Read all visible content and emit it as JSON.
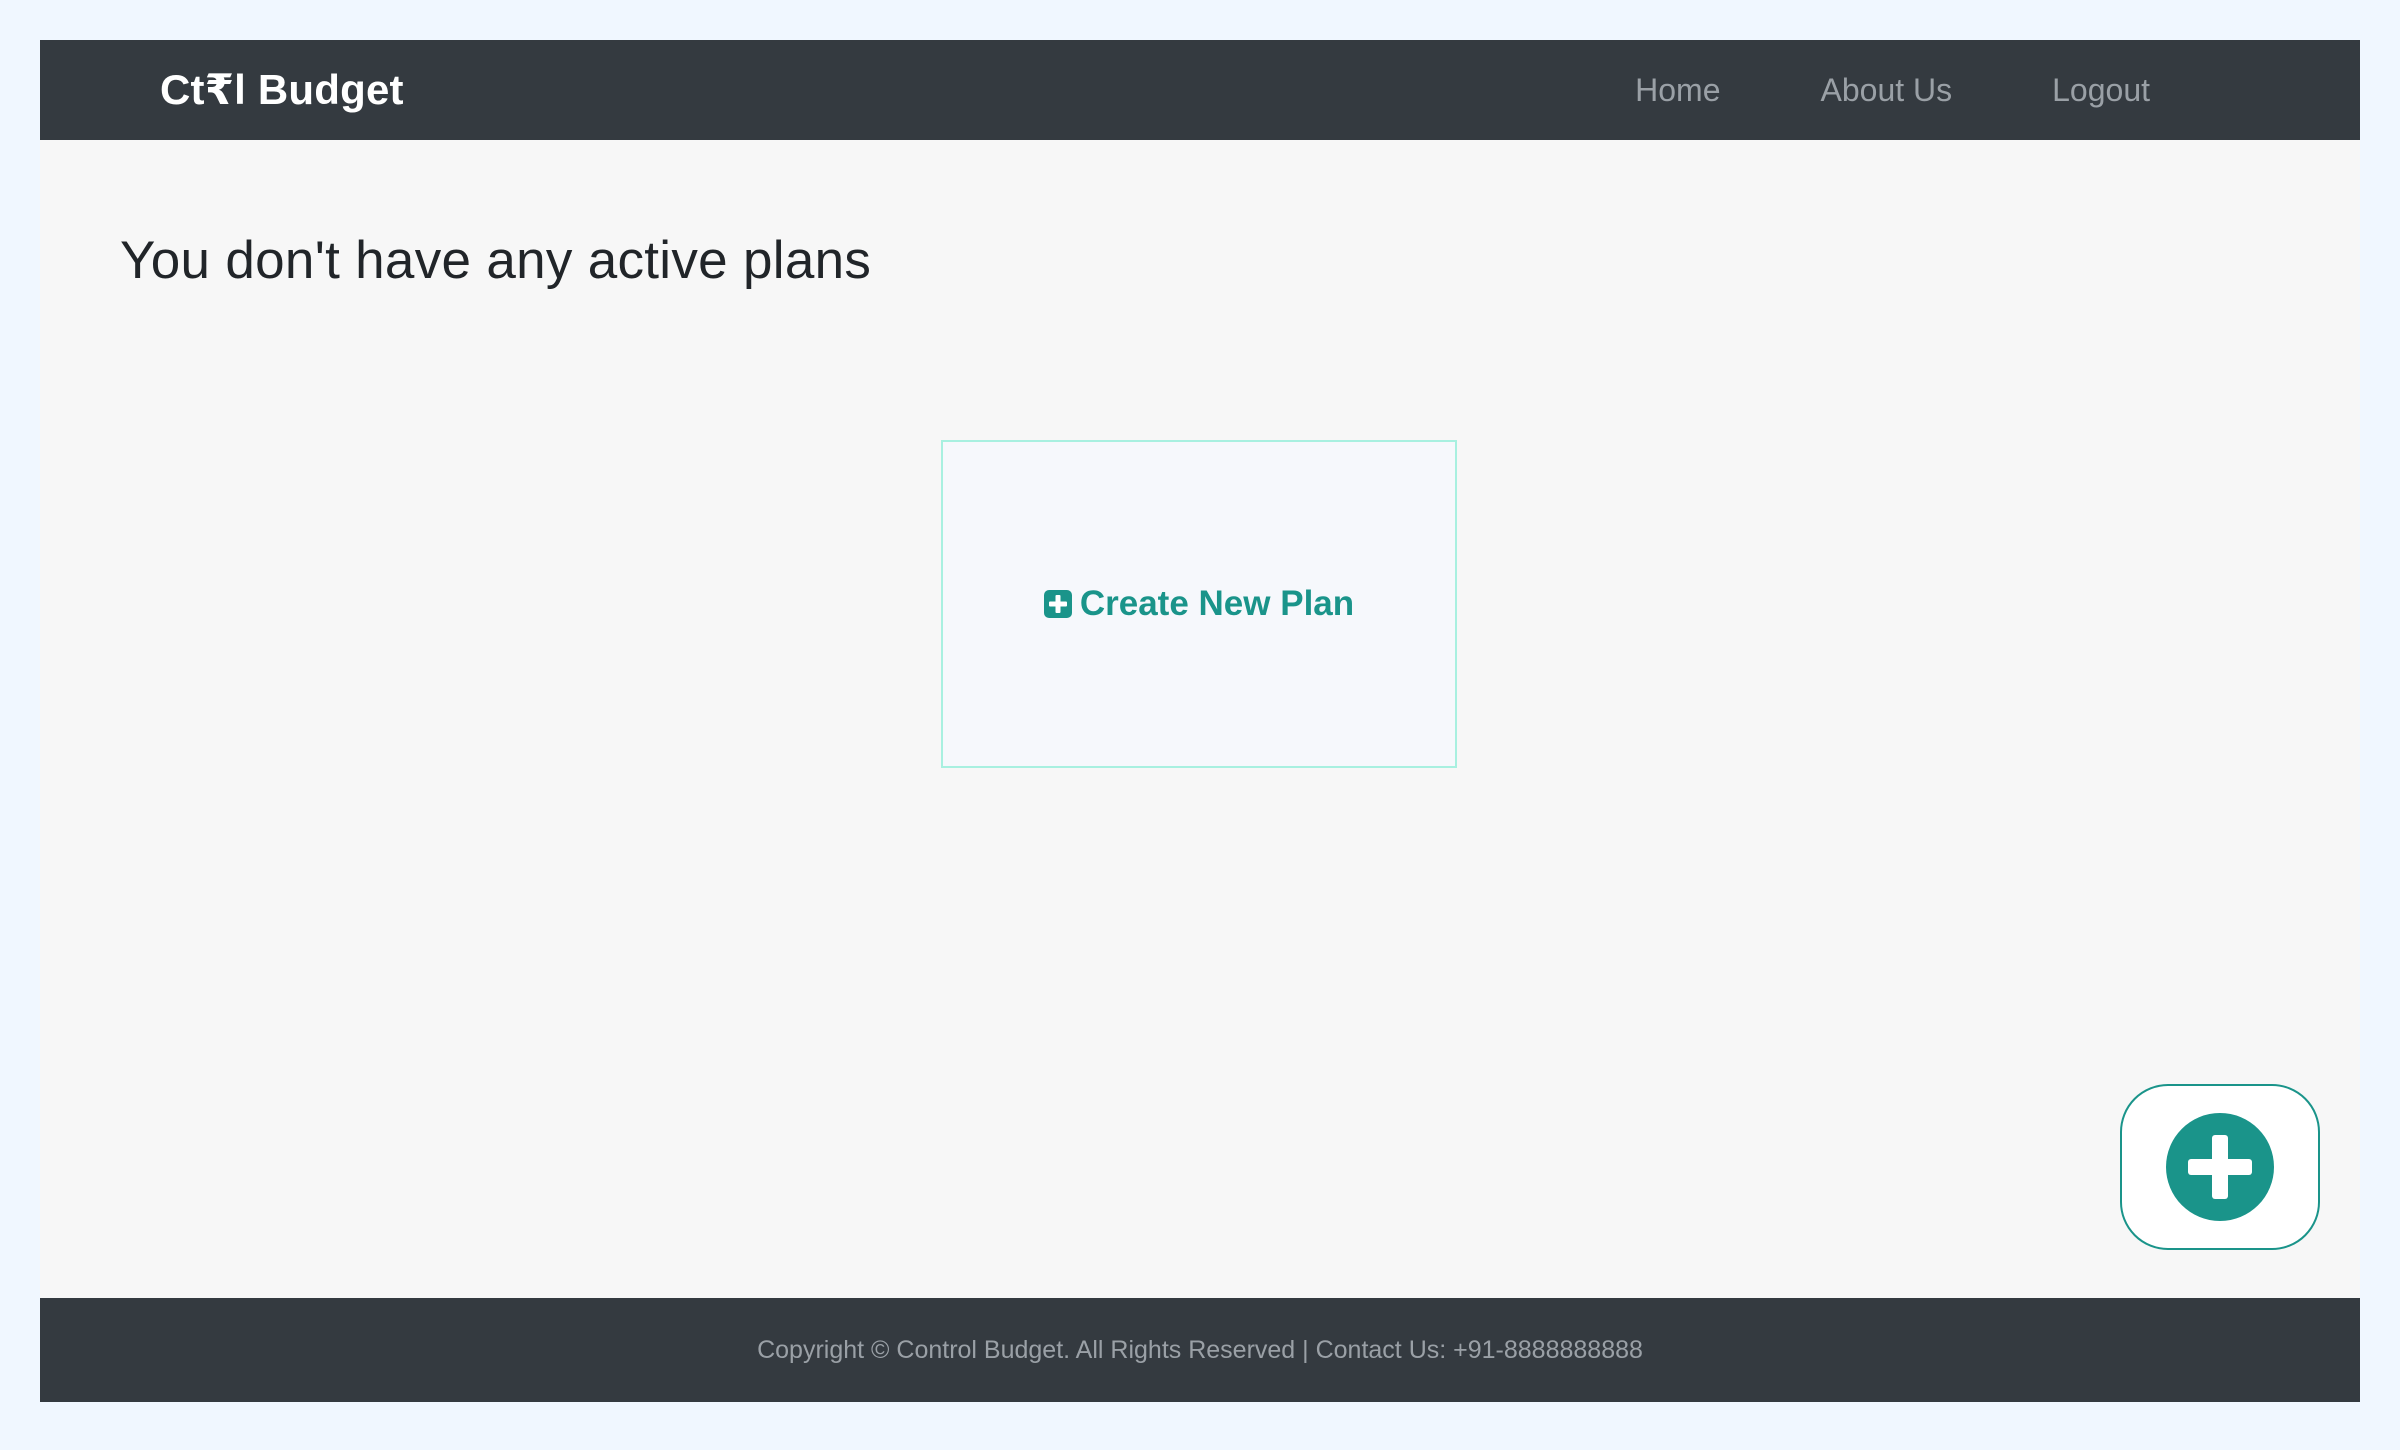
{
  "navbar": {
    "brand": "Ct₹l Budget",
    "links": [
      {
        "label": "Home"
      },
      {
        "label": "About Us"
      },
      {
        "label": "Logout"
      }
    ]
  },
  "main": {
    "heading": "You don't have any active plans",
    "create_card": {
      "label": "Create New Plan",
      "icon": "plus-square-icon"
    },
    "fab": {
      "icon": "plus-circle-icon"
    }
  },
  "footer": {
    "text": "Copyright © Control Budget. All Rights Reserved | Contact Us: +91-8888888888"
  },
  "colors": {
    "navbar_bg": "#343a40",
    "accent": "#1a948a",
    "card_border": "#a8f0e0",
    "page_bg": "#f7f7f7"
  }
}
